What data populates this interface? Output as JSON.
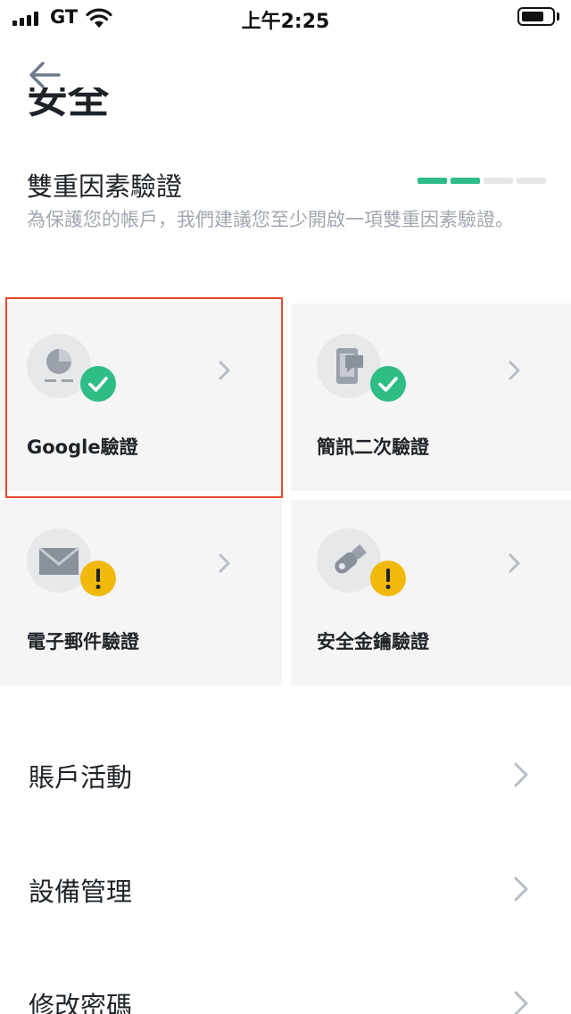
{
  "status_bar": {
    "carrier": "GT",
    "time": "上午2:25",
    "battery_level": 0.75
  },
  "page_title_partial": "安全",
  "two_factor": {
    "title": "雙重因素驗證",
    "description": "為保護您的帳戶，我們建議您至少開啟一項雙重因素驗證。",
    "strength_segments": [
      "#2ebd85",
      "#2ebd85",
      "#e6e8ea",
      "#e6e8ea"
    ],
    "cards": [
      {
        "label": "Google驗證",
        "icon": "google-authenticator-icon",
        "status": "enabled",
        "status_icon": "check-icon"
      },
      {
        "label": "簡訊二次驗證",
        "icon": "sms-phone-icon",
        "status": "enabled",
        "status_icon": "check-icon"
      },
      {
        "label": "電子郵件驗證",
        "icon": "email-envelope-icon",
        "status": "warning",
        "status_icon": "exclamation-icon"
      },
      {
        "label": "安全金鑰驗證",
        "icon": "security-key-icon",
        "status": "warning",
        "status_icon": "exclamation-icon"
      }
    ]
  },
  "list": [
    {
      "label": "賬戶活動"
    },
    {
      "label": "設備管理"
    },
    {
      "label": "修改密碼"
    }
  ],
  "colors": {
    "success": "#2ebd85",
    "warning": "#f0b90b",
    "highlight": "#e64a2e",
    "muted_text": "#a1a7b1"
  }
}
